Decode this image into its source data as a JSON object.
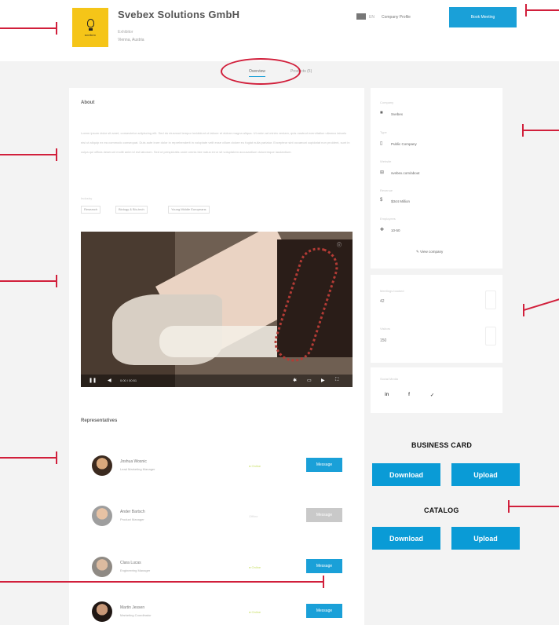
{
  "header": {
    "company_name": "Svebex Solutions GmbH",
    "logo_word": "svebex",
    "sub_line_1": "Exhibitor",
    "sub_line_2": "Vienna, Austria",
    "flag_label": "EN",
    "user_label": "Company Profile",
    "top_button_label": "Book Meeting"
  },
  "tabs": [
    {
      "label": "Overview",
      "active": true
    },
    {
      "label": "Products (5)",
      "active": false
    }
  ],
  "about": {
    "title": "About",
    "text": "Lorem ipsum dolor sit amet, consectetur adipiscing elit. Sed do eiusmod tempor incididunt ut labore et dolore magna aliqua. Ut enim ad minim veniam, quis nostrud exercitation ullamco laboris nisi ut aliquip ex ea commodo consequat. Duis aute irure dolor in reprehenderit in voluptate velit esse cillum dolore eu fugiat nulla pariatur. Excepteur sint occaecat cupidatat non proident, sunt in culpa qui officia deserunt mollit anim id est laborum. Sed ut perspiciatis unde omnis iste natus error sit voluptatem accusantium doloremque laudantium.",
    "tags_label": "Industry",
    "tags": [
      "Research",
      "Biology & Bio-tech",
      "Young Middle Europeans"
    ]
  },
  "video": {
    "time": "0:00 / 00:51",
    "info_icon": "info-icon",
    "play_icon": "play-icon"
  },
  "info": {
    "items": [
      {
        "label": "Company",
        "icon": "building-icon",
        "glyph": "■",
        "value": "Svebex"
      },
      {
        "label": "Type",
        "icon": "doc-icon",
        "glyph": "▯",
        "value": "Public Company"
      },
      {
        "label": "Website",
        "icon": "link-icon",
        "glyph": "⊞",
        "value": "svebex.com/about"
      },
      {
        "label": "Revenue",
        "icon": "dollar-icon",
        "glyph": "$",
        "value": "$344 Million"
      },
      {
        "label": "Employees",
        "icon": "users-icon",
        "glyph": "✚",
        "value": "10-50"
      }
    ],
    "view_more": "View company"
  },
  "stats": [
    {
      "label": "Meetings booked",
      "value": "42"
    },
    {
      "label": "Visitors",
      "value": "150"
    }
  ],
  "social": {
    "label": "Social Media",
    "icons": [
      {
        "name": "linkedin-icon",
        "glyph": "in"
      },
      {
        "name": "facebook-icon",
        "glyph": "f"
      },
      {
        "name": "twitter-icon",
        "glyph": "✓"
      }
    ]
  },
  "reps": {
    "title": "Representatives",
    "people": [
      {
        "name": "Joshua Wosnic",
        "title": "Lead Marketing Manager",
        "status": "● Online",
        "status_color": "#c7df62",
        "button": "Message",
        "active": true
      },
      {
        "name": "Ander Bartsch",
        "title": "Product Manager",
        "status": "Offline",
        "status_color": "#d6d6d6",
        "button": "Message",
        "active": false
      },
      {
        "name": "Clara Lucas",
        "title": "Engineering Manager",
        "status": "● Online",
        "status_color": "#c7df62",
        "button": "Message",
        "active": true
      },
      {
        "name": "Martin Jessen",
        "title": "Marketing Coordinator",
        "status": "● Online",
        "status_color": "#c7df62",
        "button": "Message",
        "active": true
      }
    ]
  },
  "business_card": {
    "heading": "BUSINESS CARD",
    "download": "Download",
    "upload": "Upload"
  },
  "catalog": {
    "heading": "CATALOG",
    "download": "Download",
    "upload": "Upload"
  },
  "colors": {
    "accent": "#1aa0d8",
    "annotation": "#d11f3b",
    "cta": "#0a9bd6"
  }
}
